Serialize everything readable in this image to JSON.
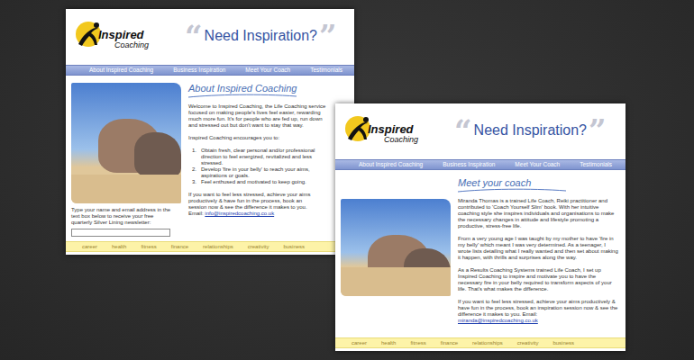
{
  "pages": [
    {
      "logo": {
        "line1": "Inspired",
        "line2": "Coaching"
      },
      "header": {
        "quote_open": "“",
        "title": "Need Inspiration?",
        "quote_close": "”"
      },
      "nav": [
        "About Inspired Coaching",
        "Business Inspiration",
        "Meet Your Coach",
        "Testimonials"
      ],
      "heading": "About Inspired Coaching",
      "blocks": [
        {
          "kind": "lines",
          "lines": [
            "Welcome to Inspired Coaching, the Life Coaching service",
            "focused on making people's lives feel easier, rewarding",
            "much more fun. It's for people who are fed up, run down",
            "and stressed out but don't want to stay that way."
          ]
        },
        {
          "kind": "lines",
          "lines": [
            "Inspired Coaching encourages you to:"
          ]
        },
        {
          "kind": "list",
          "items": [
            {
              "number": "1.",
              "lines": [
                "Obtain fresh, clear personal and/or professional",
                "direction to feel energized, revitalized and less",
                "stressed."
              ]
            },
            {
              "number": "2.",
              "lines": [
                "Develop 'fire in your belly' to reach your aims,",
                "aspirations or goals."
              ]
            },
            {
              "number": "3.",
              "lines": [
                "Feel enthused and motivated to keep going."
              ]
            }
          ]
        },
        {
          "kind": "lines",
          "lines": [
            "If you want to feel less stressed, achieve your aims",
            "productively & have fun in the process, book an",
            "session now & see the difference it makes to you."
          ],
          "prefix": "Email: ",
          "email": "info@inspiredcoaching.co.uk"
        }
      ],
      "newsletter": {
        "lines": [
          "Type your name and email address in the",
          "text box below to receive your free",
          "quarterly Silver Lining newsletter:"
        ],
        "value": ""
      },
      "footer": [
        "career",
        "health",
        "fitness",
        "finance",
        "relationships",
        "creativity",
        "business"
      ]
    },
    {
      "logo": {
        "line1": "Inspired",
        "line2": "Coaching"
      },
      "header": {
        "quote_open": "“",
        "title": "Need Inspiration?",
        "quote_close": "”"
      },
      "nav": [
        "About Inspired Coaching",
        "Business Inspiration",
        "Meet Your Coach",
        "Testimonials"
      ],
      "heading": "Meet your coach",
      "blocks": [
        {
          "kind": "para",
          "text": "Miranda Thomas is a trained Life Coach, Reiki practitioner and contributed to 'Coach Yourself Slim' book. With her intuitive coaching style she inspires individuals and organisations to make the necessary changes in attitude and lifestyle promoting a productive, stress-free life."
        },
        {
          "kind": "para",
          "text": "From a very young age I was taught by my mother to have 'fire in my belly' which meant I was very determined. As a teenager, I wrote lists detailing what I really wanted and then set about making it happen, with thrills and surprises along the way."
        },
        {
          "kind": "para",
          "text": "As a Results Coaching Systems trained Life Coach, I set up Inspired Coaching to inspire and motivate you to have the necessary fire in your belly required to transform aspects of your life. That's what makes the difference."
        },
        {
          "kind": "para",
          "text": "If you want to feel less stressed, achieve your aims productively & have fun in the process, book an inspiration session now & see the difference it makes to you. Email:",
          "email": "miranda@inspiredcoaching.co.uk"
        }
      ],
      "footer": [
        "career",
        "health",
        "fitness",
        "finance",
        "relationships",
        "creativity",
        "business"
      ]
    }
  ]
}
